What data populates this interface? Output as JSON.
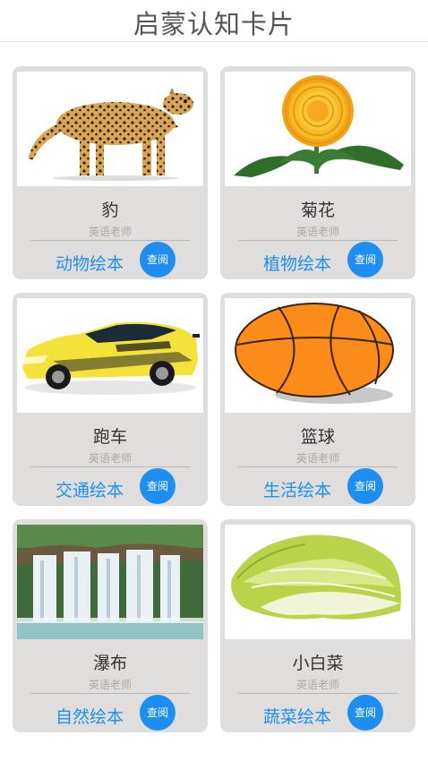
{
  "header": {
    "title": "启蒙认知卡片"
  },
  "cards": [
    {
      "name": "豹",
      "teacher": "英语老师",
      "category": "动物绘本",
      "button": "查阅",
      "image_icon": "cheetah-icon"
    },
    {
      "name": "菊花",
      "teacher": "英语老师",
      "category": "植物绘本",
      "button": "查阅",
      "image_icon": "chrysanthemum-icon"
    },
    {
      "name": "跑车",
      "teacher": "英语老师",
      "category": "交通绘本",
      "button": "查阅",
      "image_icon": "sports-car-icon"
    },
    {
      "name": "篮球",
      "teacher": "英语老师",
      "category": "生活绘本",
      "button": "查阅",
      "image_icon": "basketball-icon"
    },
    {
      "name": "瀑布",
      "teacher": "英语老师",
      "category": "自然绘本",
      "button": "查阅",
      "image_icon": "waterfall-icon"
    },
    {
      "name": "小白菜",
      "teacher": "英语老师",
      "category": "蔬菜绘本",
      "button": "查阅",
      "image_icon": "cabbage-icon"
    }
  ],
  "colors": {
    "accent": "#1e8ff0",
    "card_bg": "#e0dedd"
  }
}
